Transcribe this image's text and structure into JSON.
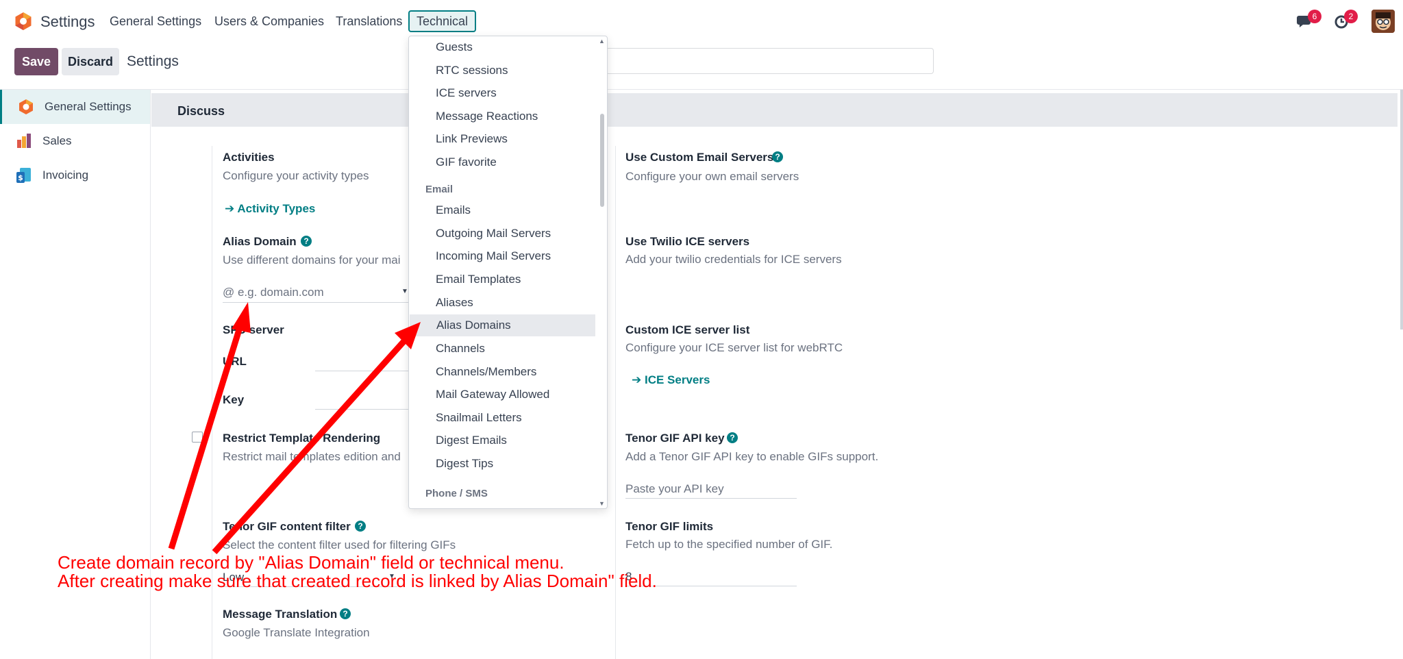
{
  "navbar": {
    "app_name": "Settings",
    "menus": [
      "General Settings",
      "Users & Companies",
      "Translations",
      "Technical"
    ],
    "chat_badge": "6",
    "activity_badge": "2"
  },
  "control": {
    "save_label": "Save",
    "discard_label": "Discard",
    "title": "Settings"
  },
  "sidebar": {
    "items": [
      {
        "label": "General Settings"
      },
      {
        "label": "Sales"
      },
      {
        "label": "Invoicing"
      }
    ]
  },
  "section": {
    "title": "Discuss"
  },
  "left_settings": {
    "activities": {
      "title": "Activities",
      "desc": "Configure your activity types",
      "link": "Activity Types"
    },
    "alias": {
      "title": "Alias Domain",
      "desc": "Use different domains for your mai",
      "placeholder": "@ e.g. domain.com"
    },
    "sfu": {
      "title": "SFU server",
      "url_label": "URL",
      "key_label": "Key"
    },
    "restrict": {
      "title": "Restrict Template Rendering",
      "desc": "Restrict mail templates edition and"
    },
    "tenor_filter": {
      "title": "Tenor GIF content filter",
      "desc": "Select the content filter used for filtering GIFs",
      "value": "Low"
    },
    "translation": {
      "title": "Message Translation",
      "desc": "Google Translate Integration"
    }
  },
  "right_settings": {
    "custom_email": {
      "title": "Use Custom Email Servers",
      "desc": "Configure your own email servers"
    },
    "twilio": {
      "title": "Use Twilio ICE servers",
      "desc": "Add your twilio credentials for ICE servers"
    },
    "ice_list": {
      "title": "Custom ICE server list",
      "desc": "Configure your ICE server list for webRTC",
      "link": "ICE Servers"
    },
    "tenor_key": {
      "title": "Tenor GIF API key",
      "desc": "Add a Tenor GIF API key to enable GIFs support.",
      "placeholder": "Paste your API key"
    },
    "tenor_limits": {
      "title": "Tenor GIF limits",
      "desc": "Fetch up to the specified number of GIF.",
      "value": "8"
    }
  },
  "dropdown": {
    "group_top": [
      "Guests",
      "RTC sessions",
      "ICE servers",
      "Message Reactions",
      "Link Previews",
      "GIF favorite"
    ],
    "email_header": "Email",
    "group_email": [
      "Emails",
      "Outgoing Mail Servers",
      "Incoming Mail Servers",
      "Email Templates",
      "Aliases",
      "Alias Domains",
      "Channels",
      "Channels/Members",
      "Mail Gateway Allowed",
      "Snailmail Letters",
      "Digest Emails",
      "Digest Tips"
    ],
    "phone_header": "Phone / SMS"
  },
  "annotation": {
    "line1": "Create domain record by \"Alias Domain\" field or technical menu.",
    "line2": "After creating make sure that created record is linked by Alias Domain\" field.",
    "color": "#ff0000"
  },
  "colors": {
    "primary": "#714b67",
    "accent": "#017e84"
  }
}
